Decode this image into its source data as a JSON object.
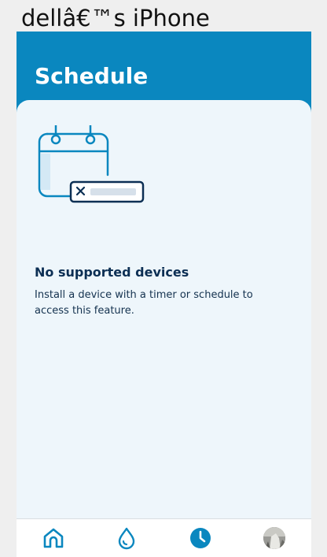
{
  "device": {
    "title": "dellâ€™s iPhone"
  },
  "header": {
    "title": "Schedule"
  },
  "empty_state": {
    "illustration_icon": "calendar-x-icon",
    "title": "No supported devices",
    "description": "Install a device with a timer or schedule to access this feature."
  },
  "tabbar": {
    "active_tab": "schedule",
    "items": [
      {
        "id": "home",
        "icon": "home-icon"
      },
      {
        "id": "water",
        "icon": "water-drop-icon"
      },
      {
        "id": "schedule",
        "icon": "clock-icon"
      },
      {
        "id": "profile",
        "icon": "avatar"
      }
    ]
  },
  "colors": {
    "header_blue": "#0a87bf",
    "content_background": "#eef6fb",
    "title_navy": "#0c2f54",
    "icon_blue": "#0a87bf",
    "icon_navy": "#0c2f54"
  }
}
